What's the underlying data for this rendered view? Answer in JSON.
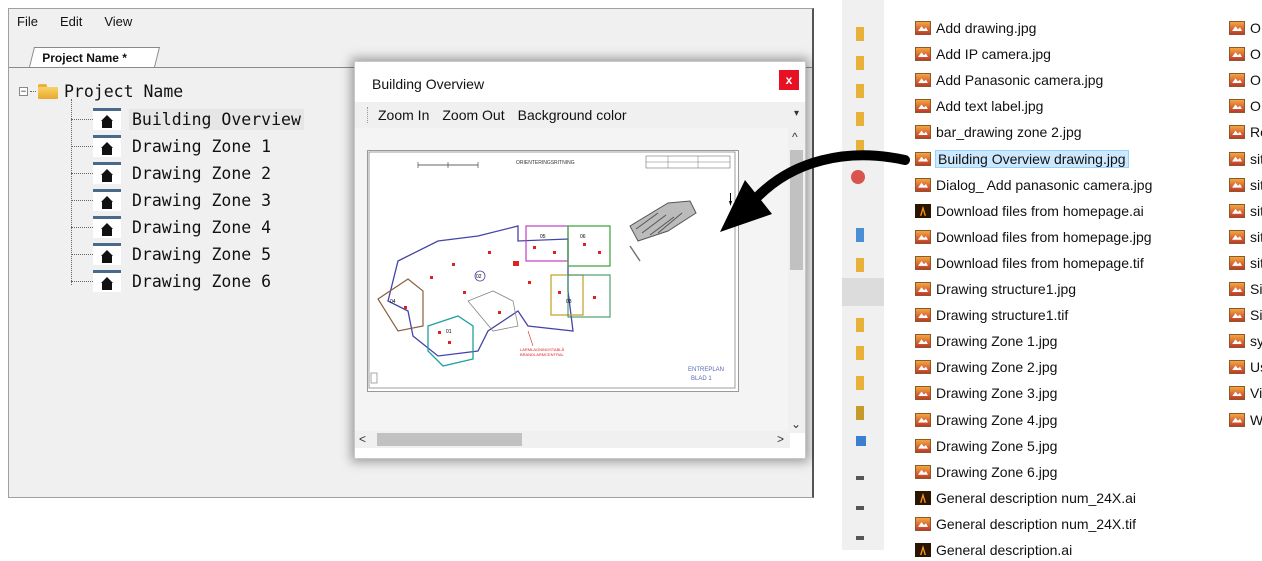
{
  "menu": {
    "file": "File",
    "edit": "Edit",
    "view": "View"
  },
  "tab": {
    "label": "Project Name *"
  },
  "tree": {
    "root": "Project Name",
    "children": [
      "Building Overview",
      "Drawing Zone 1",
      "Drawing Zone 2",
      "Drawing Zone 3",
      "Drawing Zone 4",
      "Drawing Zone 5",
      "Drawing Zone 6"
    ]
  },
  "dialog": {
    "title": "Building Overview",
    "close": "x",
    "toolbar": {
      "zoom_in": "Zoom In",
      "zoom_out": "Zoom Out",
      "background": "Background color"
    },
    "drawing": {
      "header": "ORIENTERINGSRITNING",
      "footer1": "ENTREPLAN",
      "footer2": "BLAD 1",
      "red_note1": "LARMLAGNINGSTABLÅ",
      "red_note2": "BRANDLARMCENTRAL"
    }
  },
  "files": [
    {
      "name": "Add drawing.jpg",
      "type": "jpg"
    },
    {
      "name": "Add IP camera.jpg",
      "type": "jpg"
    },
    {
      "name": "Add Panasonic camera.jpg",
      "type": "jpg"
    },
    {
      "name": "Add text label.jpg",
      "type": "jpg"
    },
    {
      "name": "bar_drawing zone 2.jpg",
      "type": "jpg"
    },
    {
      "name": "Building Overview drawing.jpg",
      "type": "jpg",
      "selected": true
    },
    {
      "name": "Dialog_ Add panasonic camera.jpg",
      "type": "jpg"
    },
    {
      "name": "Download files from homepage.ai",
      "type": "ai"
    },
    {
      "name": "Download files from homepage.jpg",
      "type": "jpg"
    },
    {
      "name": "Download files from homepage.tif",
      "type": "jpg"
    },
    {
      "name": "Drawing structure1.jpg",
      "type": "jpg"
    },
    {
      "name": "Drawing structure1.tif",
      "type": "jpg"
    },
    {
      "name": "Drawing Zone 1.jpg",
      "type": "jpg"
    },
    {
      "name": "Drawing Zone 2.jpg",
      "type": "jpg"
    },
    {
      "name": "Drawing Zone 3.jpg",
      "type": "jpg"
    },
    {
      "name": "Drawing Zone 4.jpg",
      "type": "jpg"
    },
    {
      "name": "Drawing Zone 5.jpg",
      "type": "jpg"
    },
    {
      "name": "Drawing Zone 6.jpg",
      "type": "jpg"
    },
    {
      "name": "General description num_24X.ai",
      "type": "ai"
    },
    {
      "name": "General description num_24X.tif",
      "type": "jpg"
    },
    {
      "name": "General description.ai",
      "type": "ai"
    }
  ],
  "files_col2": [
    "O",
    "O",
    "O",
    "O",
    "Re",
    "sit",
    "sit",
    "sit",
    "sit",
    "sit",
    "Si",
    "Si",
    "sy",
    "Us",
    "Vi",
    "W"
  ],
  "colors": {
    "selection": "#cce8ff",
    "close_button": "#e81123",
    "folder": "#e8b23a"
  }
}
